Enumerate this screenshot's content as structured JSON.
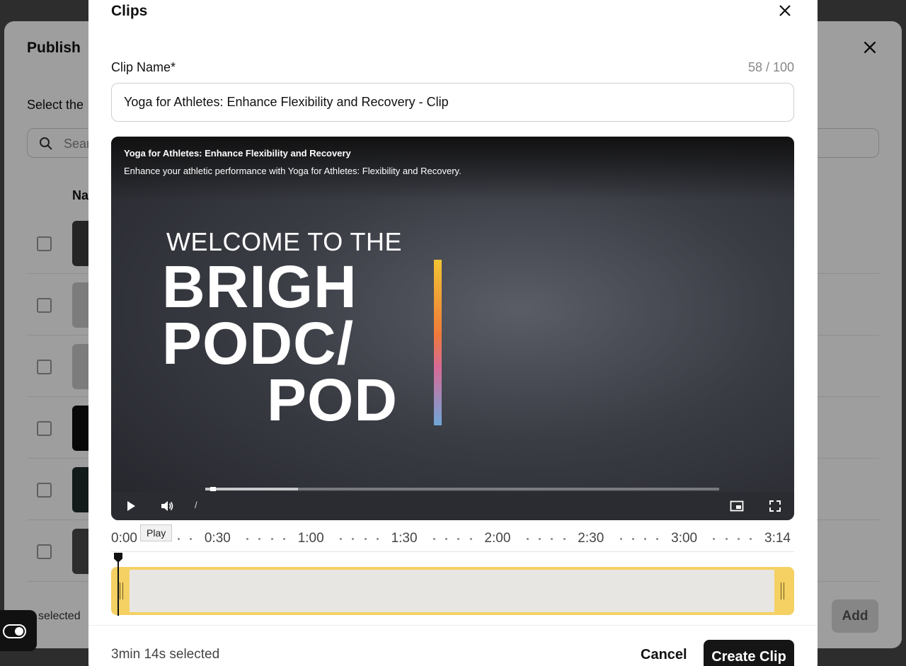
{
  "background_modal": {
    "title": "Publish",
    "subtitle": "Select the",
    "search_placeholder": "Sear",
    "column_name": "Na",
    "footer_selected": "selected",
    "add_label": "Add"
  },
  "clips_modal": {
    "title": "Clips",
    "clip_name_label": "Clip Name*",
    "char_count": "58 / 100",
    "clip_name_value": "Yoga for Athletes: Enhance Flexibility and Recovery - Clip",
    "video": {
      "title": "Yoga for Athletes: Enhance Flexibility and Recovery",
      "description": "Enhance your athletic performance with Yoga for Athletes: Flexibility and Recovery.",
      "frame_text": [
        "WELCOME TO THE",
        "BRIGH",
        "PODC/",
        "POD"
      ],
      "time_separator": "/",
      "progress_fraction": 0.01,
      "buffered_fraction": 0.18
    },
    "tooltip": "Play",
    "timeline": {
      "ticks": [
        "0:00",
        "0:30",
        "1:00",
        "1:30",
        "2:00",
        "2:30",
        "3:00",
        "3:14"
      ],
      "range_start_fraction": 0.0,
      "range_end_fraction": 1.0
    },
    "selected_summary": "3min 14s selected",
    "cancel_label": "Cancel",
    "create_label": "Create Clip",
    "accent_color": "#f5d063"
  }
}
